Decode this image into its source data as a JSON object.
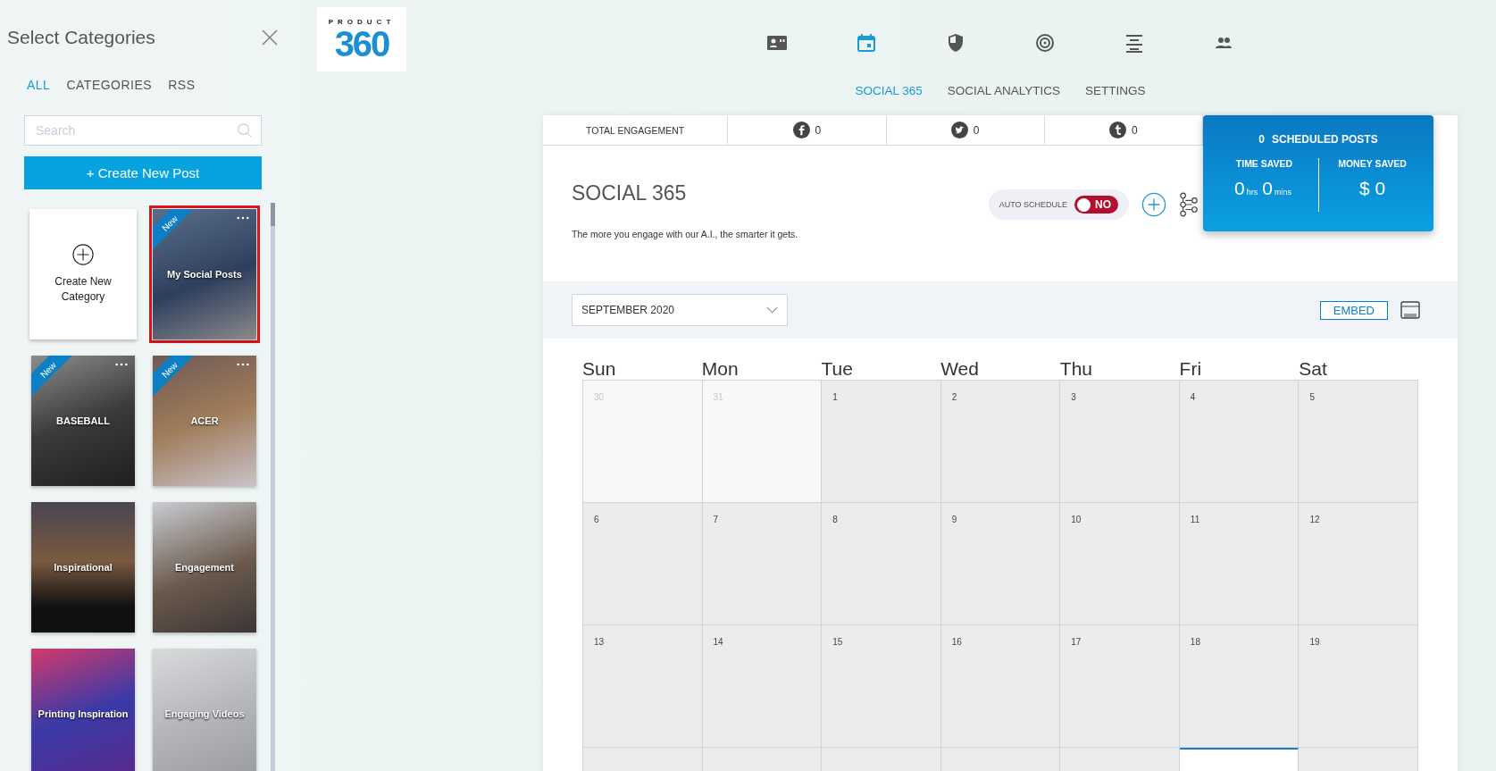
{
  "sidebar": {
    "title": "Select Categories",
    "tabs": [
      {
        "label": "ALL",
        "selected": true
      },
      {
        "label": "CATEGORIES",
        "selected": false
      },
      {
        "label": "RSS",
        "selected": false
      }
    ],
    "search": {
      "placeholder": "Search"
    },
    "create_button": "+ Create New Post",
    "new_category": {
      "label": "Create New Category"
    },
    "cards": [
      {
        "label": "My Social Posts",
        "badge": "New",
        "menu": true,
        "selected": true
      },
      {
        "label": "BASEBALL",
        "badge": "New",
        "menu": true,
        "selected": false
      },
      {
        "label": "ACER",
        "badge": "New",
        "menu": true,
        "selected": false
      },
      {
        "label": "Inspirational",
        "menu": false,
        "selected": false
      },
      {
        "label": "Engagement",
        "menu": false,
        "selected": false
      },
      {
        "label": "Printing Inspiration",
        "menu": false,
        "selected": false
      },
      {
        "label": "Engaging Videos",
        "menu": false,
        "selected": false
      }
    ]
  },
  "logo": {
    "top": "PRODUCT",
    "big": "360"
  },
  "top_icons": [
    {
      "kind": "contact",
      "selected": false
    },
    {
      "kind": "calendar",
      "selected": true
    },
    {
      "kind": "shield",
      "selected": false
    },
    {
      "kind": "target",
      "selected": false
    },
    {
      "kind": "align",
      "selected": false
    },
    {
      "kind": "people",
      "selected": false
    }
  ],
  "nav": [
    {
      "label": "SOCIAL 365",
      "selected": true
    },
    {
      "label": "SOCIAL ANALYTICS",
      "selected": false
    },
    {
      "label": "SETTINGS",
      "selected": false
    }
  ],
  "stats": [
    {
      "kind": "label",
      "text": "TOTAL ENGAGEMENT"
    },
    {
      "kind": "facebook",
      "text": "0"
    },
    {
      "kind": "twitter",
      "text": "0"
    },
    {
      "kind": "tumblr",
      "text": "0"
    }
  ],
  "summary": {
    "count": "0",
    "count_label": "SCHEDULED POSTS",
    "time_label": "TIME SAVED",
    "hours": "0",
    "hours_unit": "hrs",
    "mins": "0",
    "mins_unit": "mins",
    "money_label": "MONEY SAVED",
    "money": "$ 0"
  },
  "page": {
    "title": "SOCIAL 365",
    "subtitle": "The more you engage with our A.I., the smarter it gets.",
    "auto_schedule": {
      "label": "AUTO SCHEDULE",
      "on": false,
      "state_text": "NO"
    }
  },
  "toolbar": {
    "month": "SEPTEMBER 2020",
    "embed": "EMBED"
  },
  "calendar": {
    "weekdays": [
      "Sun",
      "Mon",
      "Tue",
      "Wed",
      "Thu",
      "Fri",
      "Sat"
    ],
    "weeks": [
      {
        "days": [
          {
            "day": "30",
            "muted": true,
            "today": false
          },
          {
            "day": "31",
            "muted": true,
            "today": false
          },
          {
            "day": "1",
            "muted": false,
            "today": false
          },
          {
            "day": "2",
            "muted": false,
            "today": false
          },
          {
            "day": "3",
            "muted": false,
            "today": false
          },
          {
            "day": "4",
            "muted": false,
            "today": false
          },
          {
            "day": "5",
            "muted": false,
            "today": false
          }
        ]
      },
      {
        "days": [
          {
            "day": "6",
            "muted": false,
            "today": false
          },
          {
            "day": "7",
            "muted": false,
            "today": false
          },
          {
            "day": "8",
            "muted": false,
            "today": false
          },
          {
            "day": "9",
            "muted": false,
            "today": false
          },
          {
            "day": "10",
            "muted": false,
            "today": false
          },
          {
            "day": "11",
            "muted": false,
            "today": false
          },
          {
            "day": "12",
            "muted": false,
            "today": false
          }
        ]
      },
      {
        "days": [
          {
            "day": "13",
            "muted": false,
            "today": false
          },
          {
            "day": "14",
            "muted": false,
            "today": false
          },
          {
            "day": "15",
            "muted": false,
            "today": false
          },
          {
            "day": "16",
            "muted": false,
            "today": false
          },
          {
            "day": "17",
            "muted": false,
            "today": false
          },
          {
            "day": "18",
            "muted": false,
            "today": false
          },
          {
            "day": "19",
            "muted": false,
            "today": false
          }
        ]
      },
      {
        "days": [
          {
            "muted": false,
            "today": false
          },
          {
            "muted": false,
            "today": false
          },
          {
            "muted": false,
            "today": false
          },
          {
            "muted": false,
            "today": false
          },
          {
            "muted": false,
            "today": false
          },
          {
            "muted": false,
            "today": true
          },
          {
            "muted": false,
            "today": false
          }
        ]
      }
    ]
  }
}
